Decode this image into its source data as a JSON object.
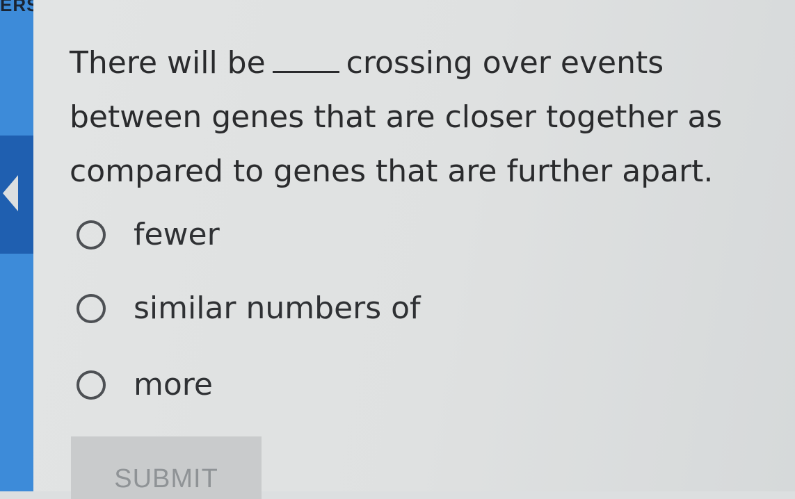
{
  "sidebar": {
    "label": "ERS"
  },
  "question": {
    "part1": "There will be",
    "part2": "crossing over events between genes that are closer together as compared to genes that are further apart."
  },
  "options": [
    {
      "label": "fewer",
      "selected": false
    },
    {
      "label": "similar numbers of",
      "selected": false
    },
    {
      "label": "more",
      "selected": false
    }
  ],
  "submit": {
    "label": "SUBMIT",
    "enabled": false
  },
  "colors": {
    "sidebar_blue": "#3d8bd9",
    "sidebar_active": "#1f5fb0",
    "text": "#2a2b2d",
    "submit_bg": "#c9cbcc",
    "submit_text": "#8f9396"
  }
}
